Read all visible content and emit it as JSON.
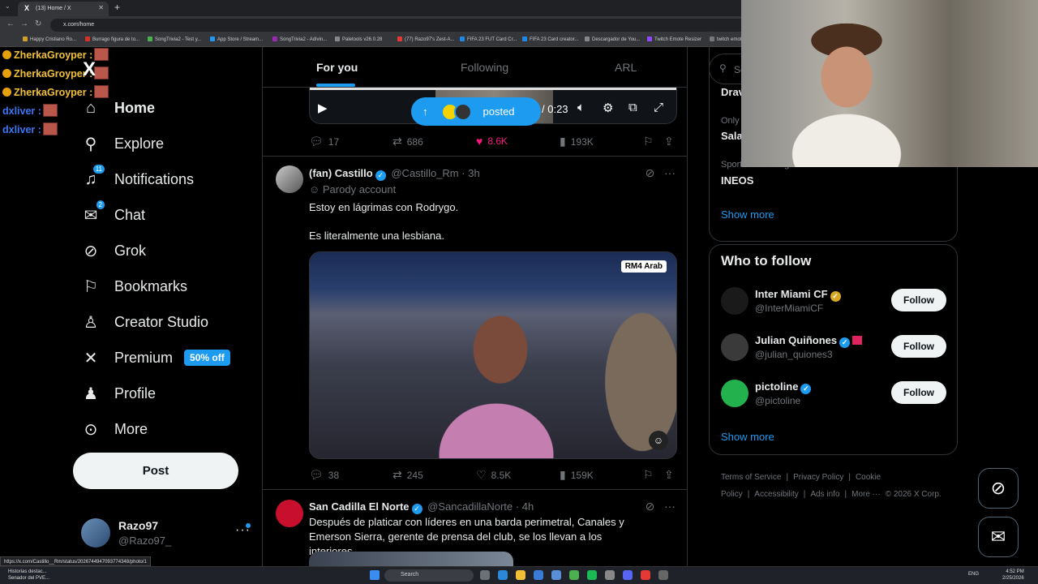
{
  "browser": {
    "tab_title": "(13) Home / X",
    "url": "x.com/home",
    "bookmarks": [
      {
        "label": "Happy Cristiano Ro...",
        "color": "#c9a227"
      },
      {
        "label": "Burrago figura de to...",
        "color": "#d93025"
      },
      {
        "label": "SongTrivia2 - Test y...",
        "color": "#4caf50"
      },
      {
        "label": "App Store / Stream...",
        "color": "#2196f3"
      },
      {
        "label": "SongTrivia2 - Adivin...",
        "color": "#9c27b0"
      },
      {
        "label": "Paletools v26.0.28",
        "color": "#888888"
      },
      {
        "label": "(77) Razo97's Zest-A...",
        "color": "#e53935"
      },
      {
        "label": "FIFA 23 FUT Card Cr...",
        "color": "#1e88e5"
      },
      {
        "label": "FIFA 23 Card creator...",
        "color": "#1e88e5"
      },
      {
        "label": "Descargador de You...",
        "color": "#888888"
      },
      {
        "label": "Twitch Emote Resizer",
        "color": "#9146ff"
      },
      {
        "label": "twitch emote re...",
        "color": "#777777"
      }
    ],
    "status_url": "https://x.com/Castillo__Rm/status/2026744947093774348/photo/1"
  },
  "chat_overlay": [
    {
      "user": "ZherkaGroyper :",
      "style": "yellow"
    },
    {
      "user": "ZherkaGroyper :",
      "style": "yellow"
    },
    {
      "user": "ZherkaGroyper :",
      "style": "yellow"
    },
    {
      "user": "dxliver :",
      "style": "blue"
    },
    {
      "user": "dxliver :",
      "style": "blue"
    }
  ],
  "nav": {
    "logo": "X",
    "items": [
      {
        "label": "Home",
        "icon": "home-icon",
        "glyph": "⌂"
      },
      {
        "label": "Explore",
        "icon": "search-icon",
        "glyph": "⚲"
      },
      {
        "label": "Notifications",
        "icon": "bell-icon",
        "glyph": "♫",
        "badge": "11"
      },
      {
        "label": "Chat",
        "icon": "mail-icon",
        "glyph": "✉",
        "badge": "2"
      },
      {
        "label": "Grok",
        "icon": "grok-icon",
        "glyph": "⊘"
      },
      {
        "label": "Bookmarks",
        "icon": "bookmark-icon",
        "glyph": "⚐"
      },
      {
        "label": "Creator Studio",
        "icon": "creator-studio-icon",
        "glyph": "♙"
      },
      {
        "label": "Premium",
        "icon": "x-premium-icon",
        "glyph": "✕",
        "pill": "50% off"
      },
      {
        "label": "Profile",
        "icon": "profile-icon",
        "glyph": "♟"
      },
      {
        "label": "More",
        "icon": "more-icon",
        "glyph": "⊙"
      }
    ],
    "post_label": "Post",
    "account": {
      "name": "Razo97",
      "handle": "@Razo97_"
    }
  },
  "timeline": {
    "tabs": [
      "For you",
      "Following",
      "ARL"
    ],
    "prev_post": {
      "posted_label": "posted",
      "time": "/ 0:23",
      "replies": "17",
      "reposts": "686",
      "likes": "8.6K",
      "views": "193K"
    },
    "tweets": [
      {
        "name": "(fan) Castillo",
        "handle": "@Castillo_Rm",
        "time": "3h",
        "label": "Parody account",
        "text1": "Estoy en lágrimas con Rodrygo.",
        "text2": "Es literalmente una lesbiana.",
        "media_brand": "RM4 Arab",
        "replies": "38",
        "reposts": "245",
        "likes": "8.5K",
        "views": "159K"
      },
      {
        "name": "San Cadilla El Norte",
        "handle": "@SancadillaNorte",
        "time": "4h",
        "text1": "Después de platicar con líderes en una barda perimetral, Canales y Emerson Sierra, gerente de prensa del club, se los llevan a los interiores."
      }
    ]
  },
  "sidebar": {
    "search_placeholder": "Se",
    "trends": [
      {
        "category": "",
        "name": "Drav"
      },
      {
        "category": "Only",
        "name": "Sala"
      },
      {
        "category": "Sports · Trending",
        "name": "INEOS"
      }
    ],
    "show_more": "Show more",
    "who_to_follow_title": "Who to follow",
    "who_to_follow": [
      {
        "name": "Inter Miami CF",
        "handle": "@InterMiamiCF",
        "badge": "gold",
        "avatar_color": "#1a1a1a"
      },
      {
        "name": "Julian Quiñones",
        "handle": "@julian_quiones3",
        "badge": "blue",
        "avatar_color": "#3a3a3a"
      },
      {
        "name": "pictoline",
        "handle": "@pictoline",
        "badge": "blue",
        "avatar_color": "#22b14c"
      }
    ],
    "follow_label": "Follow",
    "show_more_2": "Show more",
    "footer": [
      "Terms of Service",
      "|",
      "Privacy Policy",
      "|",
      "Cookie Policy",
      "|",
      "Accessibility",
      "|",
      "Ads info",
      "|",
      "More ···",
      "© 2026 X Corp."
    ]
  },
  "taskbar": {
    "news_title": "Historias destac...",
    "news_sub": "Senador del PVE...",
    "search_label": "Search",
    "tray_lang": "ENG",
    "time": "4:52 PM",
    "date": "2/25/2026"
  }
}
